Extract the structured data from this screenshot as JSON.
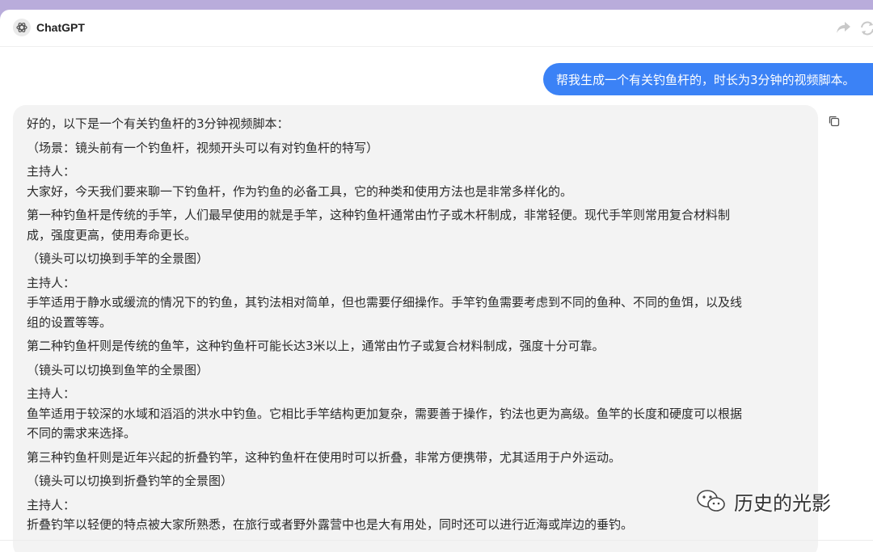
{
  "app": {
    "title": "ChatGPT"
  },
  "icons": {
    "logo": "openai-logo-icon",
    "share": "share-icon",
    "sync": "sync-icon",
    "copy": "copy-icon",
    "watermark": "wechat-icon"
  },
  "conversation": {
    "user_message": "帮我生成一个有关钓鱼杆的，时长为3分钟的视频脚本。",
    "assistant_lines": [
      "好的，以下是一个有关钓鱼杆的3分钟视频脚本：",
      "（场景：镜头前有一个钓鱼杆，视频开头可以有对钓鱼杆的特写）",
      "主持人：",
      "大家好，今天我们要来聊一下钓鱼杆，作为钓鱼的必备工具，它的种类和使用方法也是非常多样化的。",
      "第一种钓鱼杆是传统的手竿，人们最早使用的就是手竿，这种钓鱼杆通常由竹子或木杆制成，非常轻便。现代手竿则常用复合材料制",
      "成，强度更高，使用寿命更长。",
      "（镜头可以切换到手竿的全景图）",
      "主持人：",
      "手竿适用于静水或缓流的情况下的钓鱼，其钓法相对简单，但也需要仔细操作。手竿钓鱼需要考虑到不同的鱼种、不同的鱼饵，以及线",
      "组的设置等等。",
      "第二种钓鱼杆则是传统的鱼竿，这种钓鱼杆可能长达3米以上，通常由竹子或复合材料制成，强度十分可靠。",
      "（镜头可以切换到鱼竿的全景图）",
      "主持人：",
      "鱼竿适用于较深的水域和滔滔的洪水中钓鱼。它相比手竿结构更加复杂，需要善于操作，钓法也更为高级。鱼竿的长度和硬度可以根据",
      "不同的需求来选择。",
      "第三种钓鱼杆则是近年兴起的折叠钓竿，这种钓鱼杆在使用时可以折叠，非常方便携带，尤其适用于户外运动。",
      "（镜头可以切换到折叠钓竿的全景图）",
      "主持人：",
      "折叠钓竿以轻便的特点被大家所熟悉，在旅行或者野外露营中也是大有用处，同时还可以进行近海或岸边的垂钓。"
    ]
  },
  "watermark": {
    "text": "历史的光影"
  },
  "colors": {
    "accent": "#3b82f6",
    "frame": "#b9acdb",
    "bubble": "#f3f3f3"
  }
}
